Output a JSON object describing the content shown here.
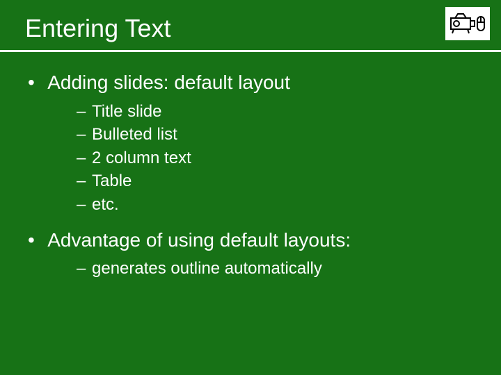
{
  "title": "Entering Text",
  "bullets": [
    {
      "text": "Adding slides: default layout",
      "sub": [
        "Title slide",
        "Bulleted list",
        "2 column text",
        "Table",
        "etc."
      ]
    },
    {
      "text": "Advantage of using default layouts:",
      "sub": [
        "generates outline automatically"
      ]
    }
  ],
  "icon": "projector-mouse-icon"
}
